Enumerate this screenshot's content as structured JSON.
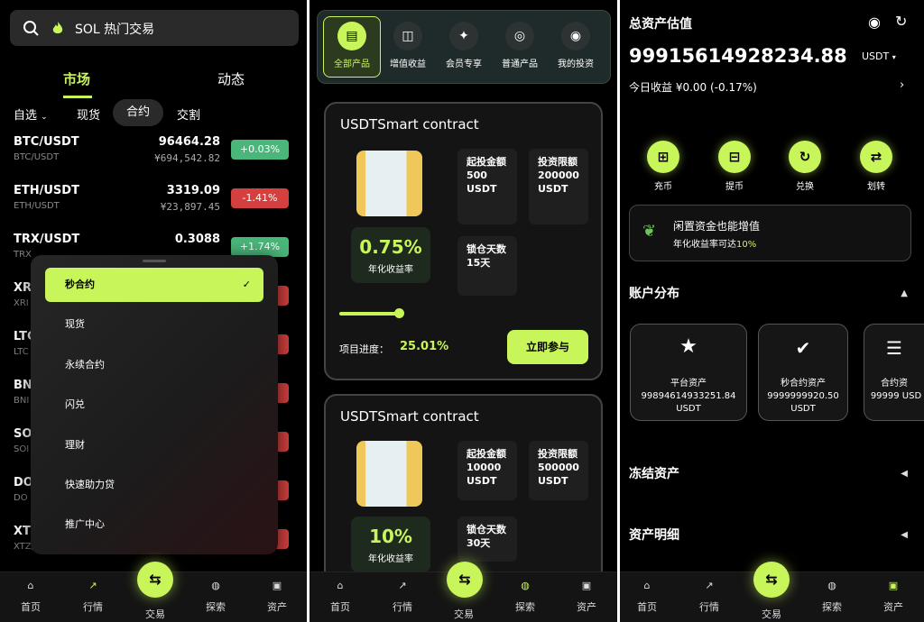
{
  "screen1": {
    "search": {
      "placeholder": "SOL 热门交易"
    },
    "top_tabs": [
      "市场",
      "动态"
    ],
    "sub_tabs": [
      "自选",
      "现货",
      "合约",
      "交割"
    ],
    "coins": [
      {
        "pair": "BTC/USDT",
        "sub": "BTC/USDT",
        "price": "96464.28",
        "cny": "¥694,542.82",
        "change": "+0.03%",
        "dir": "up"
      },
      {
        "pair": "ETH/USDT",
        "sub": "ETH/USDT",
        "price": "3319.09",
        "cny": "¥23,897.45",
        "change": "-1.41%",
        "dir": "down"
      },
      {
        "pair": "TRX/USDT",
        "sub": "TRX",
        "price": "0.3088",
        "cny": "",
        "change": "+1.74%",
        "dir": "up"
      },
      {
        "pair": "XR",
        "sub": "XRI",
        "price": "",
        "cny": "",
        "change": "",
        "dir": "down"
      },
      {
        "pair": "LTC",
        "sub": "LTC",
        "price": "",
        "cny": "",
        "change": "",
        "dir": "down"
      },
      {
        "pair": "BN",
        "sub": "BNI",
        "price": "",
        "cny": "",
        "change": "",
        "dir": "down"
      },
      {
        "pair": "SO",
        "sub": "SOI",
        "price": "",
        "cny": "",
        "change": "",
        "dir": "down"
      },
      {
        "pair": "DO",
        "sub": "DO",
        "price": "",
        "cny": "",
        "change": "",
        "dir": "down"
      },
      {
        "pair": "XT",
        "sub": "XTZ/",
        "price": "",
        "cny": "",
        "change": "",
        "dir": "down"
      }
    ],
    "menu": {
      "items": [
        "秒合约",
        "现货",
        "永续合约",
        "闪兑",
        "理财",
        "快速助力贷",
        "推广中心"
      ],
      "check": "✓"
    }
  },
  "screen2": {
    "categories": [
      "全部产品",
      "增值收益",
      "会员专享",
      "普通产品",
      "我的投资"
    ],
    "cards": [
      {
        "title": "USDTSmart contract",
        "rate": "0.75%",
        "rate_label": "年化收益率",
        "min_label": "起投金额",
        "min_value": "500 USDT",
        "limit_label": "投资限额",
        "limit_value": "200000 USDT",
        "lock_label": "锁仓天数",
        "lock_value": "15天",
        "progress_label": "项目进度：",
        "progress": "25.01%",
        "button": "立即参与"
      },
      {
        "title": "USDTSmart contract",
        "rate": "10%",
        "rate_label": "年化收益率",
        "min_label": "起投金额",
        "min_value": "10000 USDT",
        "limit_label": "投资限额",
        "limit_value": "500000 USDT",
        "lock_label": "锁仓天数",
        "lock_value": "30天"
      }
    ]
  },
  "screen3": {
    "title": "总资产估值",
    "total": "99915614928234.88",
    "currency": "USDT",
    "today": "今日收益 ¥0.00 (-0.17%)",
    "actions": [
      "充币",
      "提币",
      "兑换",
      "划转"
    ],
    "idle": {
      "title": "闲置资金也能增值",
      "sub": "年化收益率可达",
      "rate": "10%"
    },
    "distribution": "账户分布",
    "assets": [
      {
        "name": "平台资产",
        "value": "99894614933251.84 USDT"
      },
      {
        "name": "秒合约资产",
        "value": "9999999920.50 USDT"
      },
      {
        "name": "合约资",
        "value": "99999 USD"
      }
    ],
    "frozen": "冻结资产",
    "detail": "资产明细"
  },
  "nav": [
    "首页",
    "行情",
    "交易",
    "探索",
    "资产"
  ],
  "colors": {
    "accent": "#c8f55a",
    "up": "#4ab67a",
    "down": "#d4403f"
  }
}
